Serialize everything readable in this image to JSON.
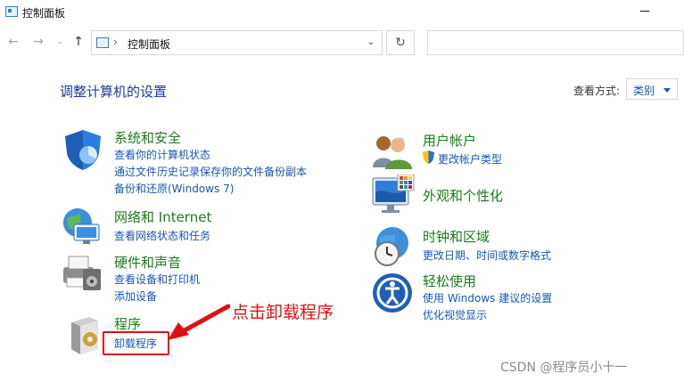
{
  "window": {
    "title": "控制面板"
  },
  "address_bar": {
    "path": "控制面板",
    "separator": "›"
  },
  "content": {
    "heading": "调整计算机的设置",
    "view_by_label": "查看方式:",
    "view_by_value": "类别"
  },
  "categories": {
    "system_security": {
      "title": "系统和安全",
      "links": [
        "查看你的计算机状态",
        "通过文件历史记录保存你的文件备份副本",
        "备份和还原(Windows 7)"
      ]
    },
    "network": {
      "title": "网络和 Internet",
      "links": [
        "查看网络状态和任务"
      ]
    },
    "hardware": {
      "title": "硬件和声音",
      "links": [
        "查看设备和打印机",
        "添加设备"
      ]
    },
    "programs": {
      "title": "程序",
      "links": [
        "卸载程序"
      ]
    },
    "user_accounts": {
      "title": "用户帐户",
      "links": [
        "更改帐户类型"
      ]
    },
    "appearance": {
      "title": "外观和个性化",
      "links": []
    },
    "clock_region": {
      "title": "时钟和区域",
      "links": [
        "更改日期、时间或数字格式"
      ]
    },
    "ease_of_access": {
      "title": "轻松使用",
      "links": [
        "使用 Windows 建议的设置",
        "优化视觉显示"
      ]
    }
  },
  "annotation": {
    "text": "点击卸载程序",
    "color": "#e01010"
  },
  "watermark": "CSDN @程序员小十一",
  "colors": {
    "category_title": "#1c7a1c",
    "link": "#1a56b3",
    "heading": "#1e3a8a"
  },
  "icons": [
    "back-arrow-icon",
    "forward-arrow-icon",
    "recent-dropdown-icon",
    "up-arrow-icon",
    "control-panel-icon",
    "refresh-icon",
    "shield-icon",
    "network-globe-icon",
    "printer-icon",
    "programs-box-icon",
    "users-icon",
    "uac-shield-icon",
    "monitor-palette-icon",
    "clock-globe-icon",
    "ease-of-access-icon"
  ]
}
